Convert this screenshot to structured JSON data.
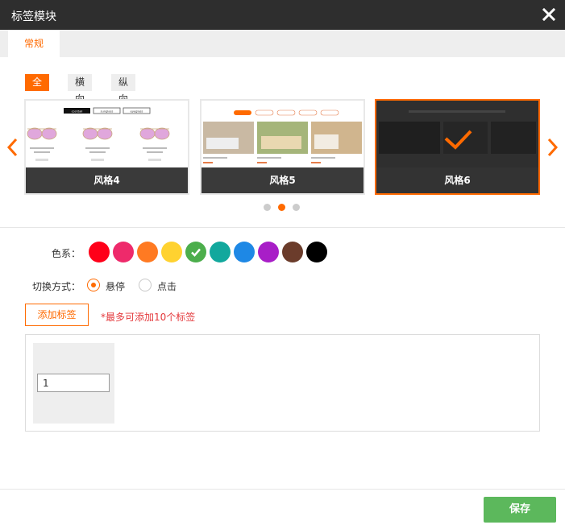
{
  "dialog": {
    "title": "标签模块"
  },
  "tabs": [
    {
      "label": "常规"
    }
  ],
  "filters": [
    {
      "label": "全部",
      "active": true
    },
    {
      "label": "横向"
    },
    {
      "label": "纵向"
    }
  ],
  "styles": [
    {
      "label": "风格4",
      "thumb_text": [
        "cocktail",
        "sunglass",
        "eyeglass"
      ]
    },
    {
      "label": "风格5"
    },
    {
      "label": "风格6",
      "selected": true
    }
  ],
  "carousel": {
    "page_count": 3,
    "active_page": 2
  },
  "colors": {
    "label": "色系：",
    "swatches": [
      "#ff0019",
      "#ee2a6b",
      "#ff7a22",
      "#ffd230",
      "#4cae4c",
      "#12a89d",
      "#1e88e5",
      "#a81ec7",
      "#6b3c2b",
      "#000000"
    ],
    "selected_index": 4
  },
  "switch_mode": {
    "label": "切换方式：",
    "options": [
      {
        "label": "悬停",
        "checked": true
      },
      {
        "label": "点击",
        "checked": false
      }
    ]
  },
  "tags": {
    "add_label": "添加标签",
    "hint": "*最多可添加10个标签",
    "items": [
      {
        "value": "1"
      }
    ]
  },
  "footer": {
    "save_label": "保存"
  },
  "theme": {
    "accent": "#ff6a00",
    "save": "#5cb85c",
    "titlebar": "#2e2e2e"
  }
}
